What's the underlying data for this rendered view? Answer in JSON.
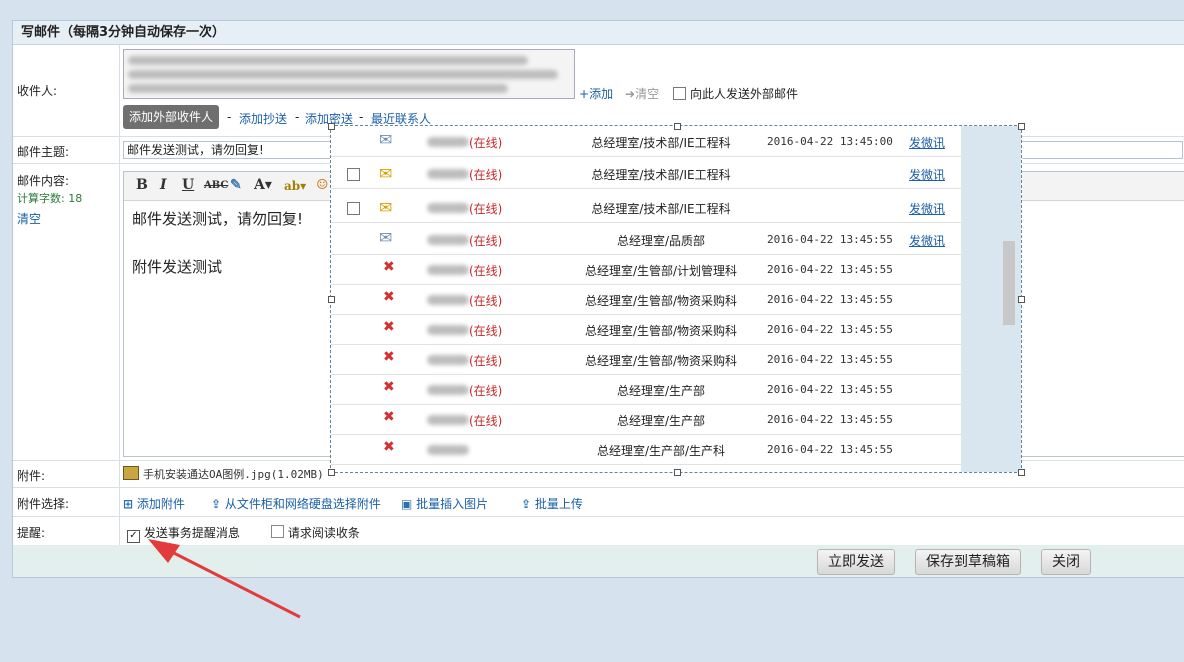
{
  "header": {
    "title": "写邮件（每隔3分钟自动保存一次）"
  },
  "labels": {
    "recipient": "收件人:",
    "subject": "邮件主题:",
    "content": "邮件内容:",
    "count_label": "计算字数: 18",
    "clear_content": "清空",
    "attachment": "附件:",
    "attachment_select": "附件选择:",
    "reminder": "提醒:"
  },
  "recipient": {
    "add": "添加",
    "clear": "清空",
    "external_checkbox": "向此人发送外部邮件",
    "add_external_button": "添加外部收件人",
    "add_cc": "添加抄送",
    "add_bcc": "添加密送",
    "recent_contacts": "最近联系人",
    "sep": "-"
  },
  "subject": {
    "value": "邮件发送测试，请勿回复!"
  },
  "editor": {
    "line1": "邮件发送测试，请勿回复!",
    "line2": "附件发送测试"
  },
  "attachment": {
    "file": "手机安装通达OA图例.jpg(1.02MB)"
  },
  "attach_options": {
    "add": "添加附件",
    "from_cabinet": "从文件柜和网络硬盘选择附件",
    "batch_insert": "批量插入图片",
    "batch_upload": "批量上传"
  },
  "reminder": {
    "send_reminder": "发送事务提醒消息",
    "read_receipt": "请求阅读收条"
  },
  "footer": {
    "send": "立即发送",
    "draft": "保存到草稿箱",
    "close": "关闭"
  },
  "popup_rows": [
    {
      "status": "(在线)",
      "dept": "总经理室/技术部/IE工程科",
      "time": "2016-04-22 13:45:00",
      "action": "发微讯",
      "icon": "envelope-open-icon"
    },
    {
      "status": "(在线)",
      "dept": "总经理室/技术部/IE工程科",
      "time": "",
      "action": "发微讯",
      "icon": "envelope-icon"
    },
    {
      "status": "(在线)",
      "dept": "总经理室/技术部/IE工程科",
      "time": "",
      "action": "发微讯",
      "icon": "envelope-icon"
    },
    {
      "status": "(在线)",
      "dept": "总经理室/品质部",
      "time": "2016-04-22 13:45:55",
      "action": "发微讯",
      "icon": "envelope-open-icon"
    },
    {
      "status": "(在线)",
      "dept": "总经理室/生管部/计划管理科",
      "time": "2016-04-22 13:45:55",
      "action": "",
      "icon": "x-icon"
    },
    {
      "status": "(在线)",
      "dept": "总经理室/生管部/物资采购科",
      "time": "2016-04-22 13:45:55",
      "action": "",
      "icon": "x-icon"
    },
    {
      "status": "(在线)",
      "dept": "总经理室/生管部/物资采购科",
      "time": "2016-04-22 13:45:55",
      "action": "",
      "icon": "x-icon"
    },
    {
      "status": "(在线)",
      "dept": "总经理室/生管部/物资采购科",
      "time": "2016-04-22 13:45:55",
      "action": "",
      "icon": "x-icon"
    },
    {
      "status": "(在线)",
      "dept": "总经理室/生产部",
      "time": "2016-04-22 13:45:55",
      "action": "",
      "icon": "x-icon"
    },
    {
      "status": "(在线)",
      "dept": "总经理室/生产部",
      "time": "2016-04-22 13:45:55",
      "action": "",
      "icon": "x-icon"
    },
    {
      "status": "",
      "dept": "总经理室/生产部/生产科",
      "time": "2016-04-22 13:45:55",
      "action": "",
      "icon": "x-icon"
    }
  ]
}
